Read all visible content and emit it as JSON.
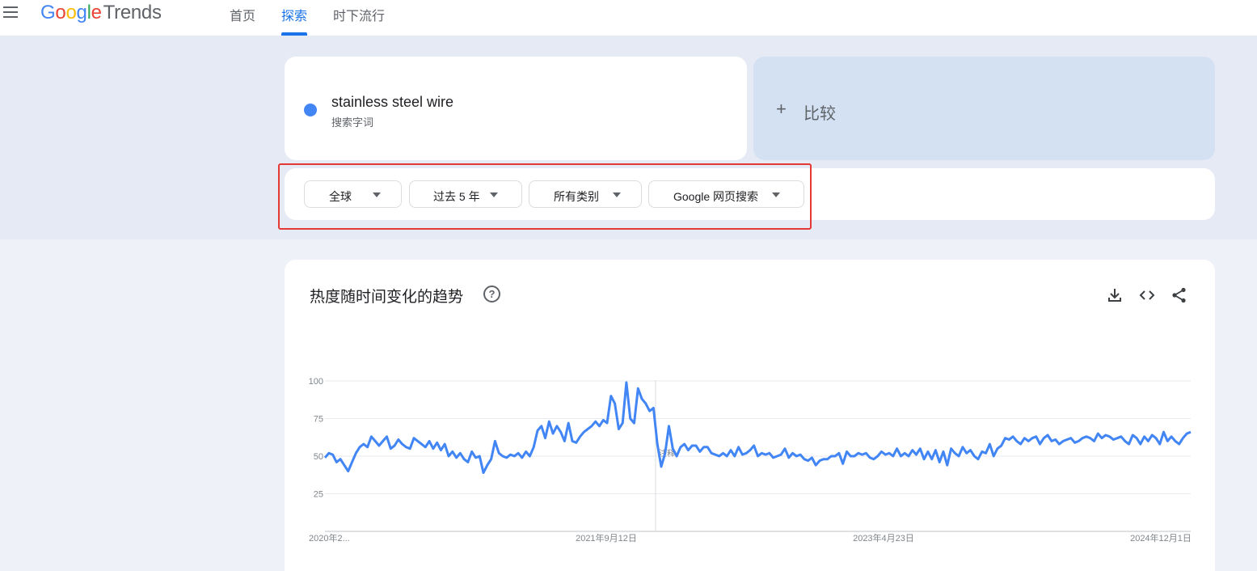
{
  "header": {
    "logo_google": "Google",
    "logo_trends": "Trends",
    "tabs": [
      {
        "label": "首页",
        "active": false
      },
      {
        "label": "探索",
        "active": true
      },
      {
        "label": "时下流行",
        "active": false
      }
    ]
  },
  "term": {
    "name": "stainless steel wire",
    "subtitle": "搜索字词",
    "color": "#4285f4"
  },
  "compare": {
    "plus": "+",
    "label": "比较"
  },
  "filters": {
    "region": "全球",
    "time": "过去 5 年",
    "category": "所有类别",
    "property": "Google 网页搜索"
  },
  "chart_title": "热度随时间变化的趋势",
  "chart_data": {
    "type": "line",
    "title": "热度随时间变化的趋势",
    "ylim": [
      0,
      100
    ],
    "y_ticks": [
      25,
      50,
      75,
      100
    ],
    "x_tick_labels": [
      "2020年2...",
      "2021年9月12日",
      "2023年4月23日",
      "2024年12月1日"
    ],
    "annotation": "注释",
    "grid": true,
    "series": [
      {
        "color": "#4285f4",
        "values": [
          49,
          52,
          51,
          46,
          48,
          44,
          40,
          46,
          52,
          56,
          58,
          56,
          63,
          60,
          57,
          60,
          63,
          55,
          57,
          61,
          58,
          56,
          55,
          62,
          60,
          58,
          56,
          60,
          55,
          59,
          54,
          58,
          50,
          53,
          49,
          52,
          48,
          46,
          53,
          49,
          50,
          39,
          44,
          48,
          60,
          52,
          50,
          49,
          51,
          50,
          52,
          49,
          53,
          50,
          56,
          67,
          70,
          62,
          73,
          65,
          70,
          66,
          60,
          72,
          60,
          59,
          63,
          66,
          68,
          70,
          73,
          70,
          74,
          72,
          90,
          85,
          68,
          72,
          99,
          75,
          72,
          95,
          88,
          85,
          80,
          82,
          58,
          43,
          52,
          70,
          55,
          50,
          56,
          58,
          54,
          57,
          57,
          53,
          56,
          56,
          52,
          51,
          50,
          52,
          50,
          54,
          50,
          56,
          51,
          52,
          54,
          57,
          50,
          52,
          51,
          52,
          49,
          50,
          51,
          55,
          49,
          52,
          50,
          51,
          48,
          47,
          49,
          44,
          47,
          48,
          48,
          50,
          50,
          52,
          45,
          53,
          50,
          50,
          52,
          51,
          52,
          49,
          48,
          50,
          53,
          51,
          52,
          50,
          55,
          50,
          52,
          50,
          54,
          51,
          55,
          48,
          53,
          48,
          54,
          46,
          53,
          44,
          55,
          52,
          50,
          56,
          52,
          54,
          50,
          48,
          53,
          52,
          58,
          50,
          55,
          57,
          62,
          61,
          63,
          60,
          58,
          62,
          60,
          62,
          63,
          58,
          62,
          64,
          60,
          61,
          58,
          60,
          61,
          62,
          59,
          60,
          62,
          63,
          62,
          60,
          65,
          62,
          64,
          63,
          61,
          62,
          63,
          60,
          58,
          64,
          62,
          58,
          63,
          60,
          64,
          62,
          58,
          66,
          60,
          63,
          60,
          58,
          62,
          65,
          66
        ]
      }
    ]
  }
}
